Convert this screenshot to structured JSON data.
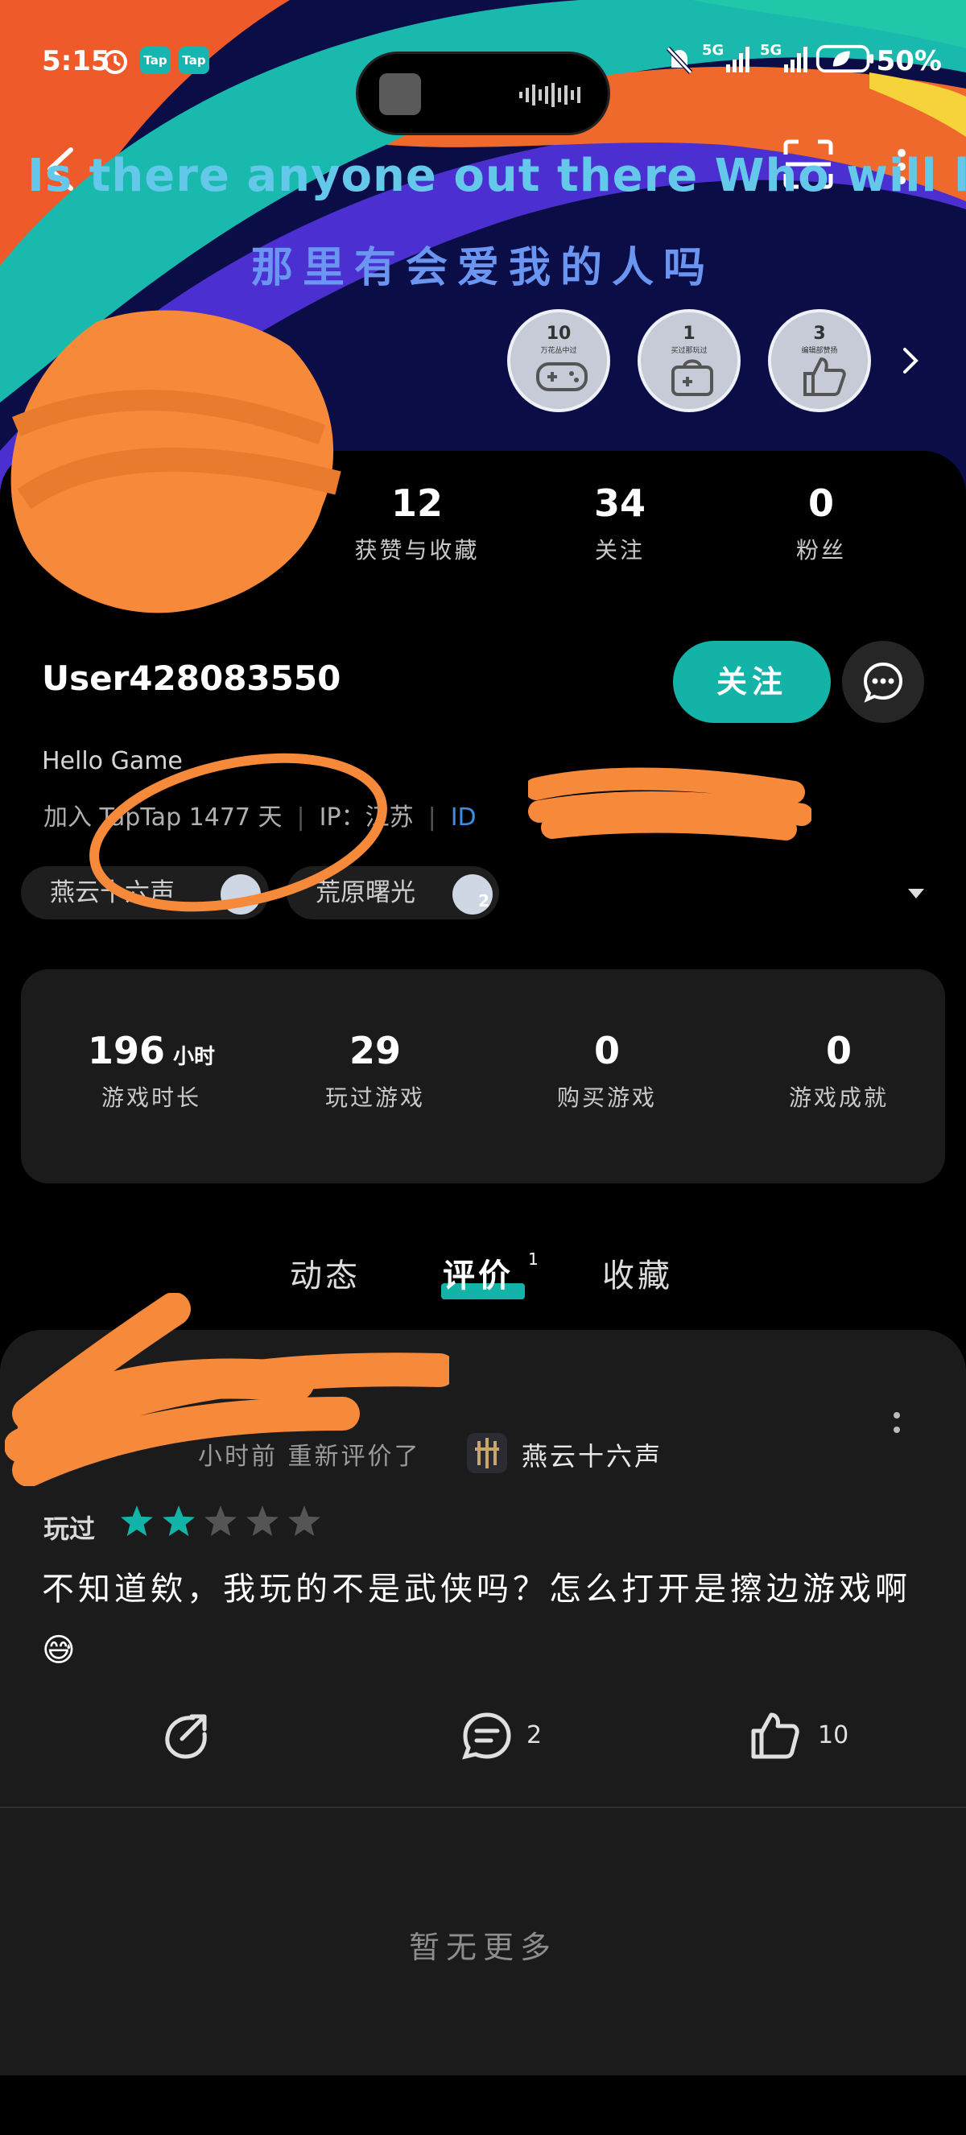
{
  "status_bar": {
    "time": "5:15",
    "app_badge_1": "Tap",
    "app_badge_2": "Tap",
    "network_1": "5G",
    "network_2": "5G",
    "battery": "50%"
  },
  "banner": {
    "marquee_en": "Is there anyone out there Who will lc",
    "marquee_cn": "那里有会爱我的人吗",
    "badges": [
      {
        "count": "10",
        "caption": "万花丛中过",
        "icon": "gamepad-icon"
      },
      {
        "count": "1",
        "caption": "买过那玩过",
        "icon": "shopping-bag-icon"
      },
      {
        "count": "3",
        "caption": "编辑部赞扬",
        "icon": "thumbs-up-icon"
      }
    ]
  },
  "profile": {
    "stats": [
      {
        "value": "12",
        "label": "获赞与收藏"
      },
      {
        "value": "34",
        "label": "关注"
      },
      {
        "value": "0",
        "label": "粉丝"
      }
    ],
    "username": "User428083550",
    "follow_label": "关注",
    "bio": "Hello Game",
    "meta": {
      "joined": "加入 TapTap 1477 天",
      "location": "IP：江苏",
      "id": "ID"
    },
    "tags": [
      {
        "label": "燕云十六声"
      },
      {
        "label": "荒原曙光",
        "level": "2"
      }
    ]
  },
  "game_stats": [
    {
      "value": "196",
      "unit": "小时",
      "label": "游戏时长"
    },
    {
      "value": "29",
      "label": "玩过游戏"
    },
    {
      "value": "0",
      "label": "购买游戏"
    },
    {
      "value": "0",
      "label": "游戏成就"
    }
  ],
  "tabs": {
    "items": [
      "动态",
      "评价",
      "收藏"
    ],
    "active": "评价",
    "review_count": "1"
  },
  "review": {
    "time_action": "小时前  重新评价了",
    "game": "燕云十六声",
    "played_label": "玩过",
    "rating": 2,
    "rating_max": 5,
    "text": "不知道欸，我玩的不是武侠吗？怎么打开是擦边游戏啊😅",
    "comments": "2",
    "likes": "10"
  },
  "footer": {
    "no_more": "暂无更多"
  },
  "colors": {
    "accent": "#14b3a8",
    "link": "#3a8ee6",
    "scribble": "#f7893a"
  }
}
